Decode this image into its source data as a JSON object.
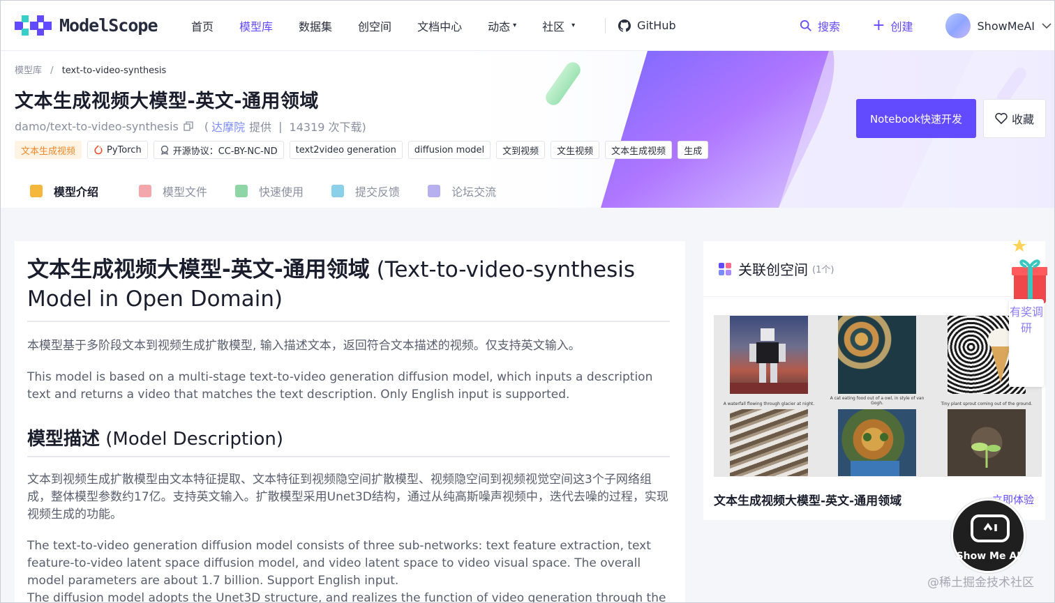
{
  "nav": {
    "logo_text": "ModelScope",
    "items": [
      {
        "label": "首页",
        "active": false
      },
      {
        "label": "模型库",
        "active": true
      },
      {
        "label": "数据集",
        "active": false
      },
      {
        "label": "创空间",
        "active": false
      },
      {
        "label": "文档中心",
        "active": false
      },
      {
        "label": "动态",
        "caret": "▾",
        "active": false
      },
      {
        "label": "社区",
        "caret": "▾",
        "active": false
      }
    ],
    "github": "GitHub",
    "search": "搜索",
    "create": "创建",
    "username": "ShowMeAI",
    "accent": "#624aff"
  },
  "breadcrumb": {
    "root": "模型库",
    "sep": "/",
    "current": "text-to-video-synthesis"
  },
  "model": {
    "title": "文本生成视频大模型-英文-通用领域",
    "id": "damo/text-to-video-synthesis",
    "paren_open": "(",
    "org": "达摩院",
    "provided": "提供",
    "sep": "|",
    "downloads": "14319 次下载)",
    "tags": [
      {
        "label": "文本生成视频",
        "kind": "task"
      },
      {
        "label": "PyTorch",
        "icon": "pytorch-icon"
      },
      {
        "label": "开源协议：CC-BY-NC-ND",
        "icon": "license-icon"
      },
      {
        "label": "text2video generation"
      },
      {
        "label": "diffusion model"
      },
      {
        "label": "文到视频"
      },
      {
        "label": "文生视频"
      },
      {
        "label": "文本生成视频"
      },
      {
        "label": "生成"
      }
    ]
  },
  "actions": {
    "notebook": "Notebook快速开发",
    "favorite": "收藏"
  },
  "tabs": [
    {
      "label": "模型介绍",
      "active": true,
      "color": "#f5b73c"
    },
    {
      "label": "模型文件",
      "active": false,
      "color": "#f3a7ad"
    },
    {
      "label": "快速使用",
      "active": false,
      "color": "#8fd6a6"
    },
    {
      "label": "提交反馈",
      "active": false,
      "color": "#8ccfe8"
    },
    {
      "label": "论坛交流",
      "active": false,
      "color": "#b6b1ee"
    }
  ],
  "doc": {
    "h1_cn": "文本生成视频大模型-英文-通用领域",
    "h1_en": " (Text-to-video-synthesis Model in Open Domain)",
    "p1_cn": "本模型基于多阶段文本到视频生成扩散模型, 输入描述文本，返回符合文本描述的视频。仅支持英文输入。",
    "p1_en": "This model is based on a multi-stage text-to-video generation diffusion model, which inputs a description text and returns a video that matches the text description. Only English input is supported.",
    "h2_cn": "模型描述",
    "h2_en": " (Model Description)",
    "p2_cn": "文本到视频生成扩散模型由文本特征提取、文本特征到视频隐空间扩散模型、视频隐空间到视频视觉空间这3个子网络组成，整体模型参数约17亿。支持英文输入。扩散模型采用Unet3D结构，通过从纯高斯噪声视频中，迭代去噪的过程，实现视频生成的功能。",
    "p2_en": "The text-to-video generation diffusion model consists of three sub-networks: text feature extraction, text feature-to-video latent space diffusion model, and video latent space to video visual space. The overall model parameters are about 1.7 billion. Support English input.",
    "p3_en": "The diffusion model adopts the Unet3D structure, and realizes the function of video generation through the iter"
  },
  "side": {
    "title": "关联创空间",
    "count": "(1个)",
    "captions": [
      "A waterfall flowing through glacier at night.",
      "A cat eating food out of a owl, in style of van Gogh.",
      "Tiny plant sprout coming out of the ground."
    ],
    "space_name": "文本生成视频大模型-英文-通用领域",
    "link": "立即体验"
  },
  "survey": {
    "text": "有奖调研"
  },
  "watermark": {
    "badge": "Show Me AI",
    "site": "@稀土掘金技术社区"
  }
}
